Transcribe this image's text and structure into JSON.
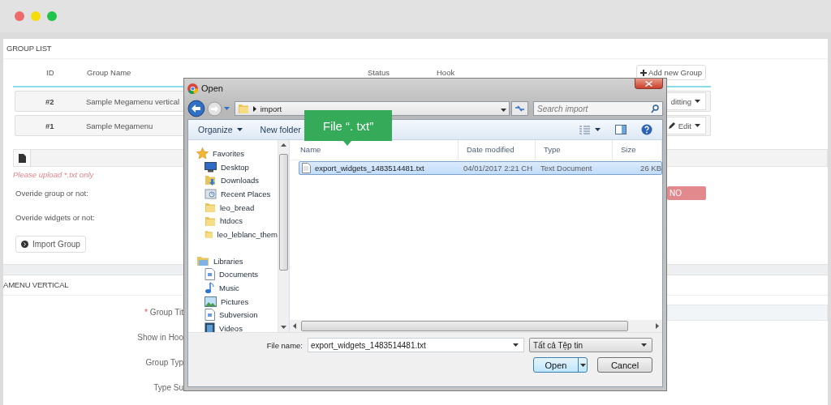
{
  "window": {
    "controls": [
      {
        "color": "#ee6b6b"
      },
      {
        "color": "#f5dc0c"
      },
      {
        "color": "#22c34a"
      }
    ]
  },
  "group_list": {
    "title": "GROUP LIST",
    "columns": [
      "ID",
      "Group Name",
      "Status",
      "Hook"
    ],
    "add_button": "Add new Group",
    "rows": [
      {
        "id": "#2",
        "name": "Sample Megamenu vertical",
        "action": "ditting"
      },
      {
        "id": "#1",
        "name": "Sample Megamenu",
        "action": "Edit"
      }
    ]
  },
  "import": {
    "hint": "Please upload *.txt only",
    "options": [
      {
        "label": "Overide group or not:",
        "toggle": "NO"
      },
      {
        "label": "Overide widgets or not:"
      }
    ],
    "button": "Import Group"
  },
  "form": {
    "title": "AMENU VERTICAL",
    "fields": [
      {
        "label": "Group Tit",
        "marker": "*"
      },
      {
        "label": "Show in Hoo"
      },
      {
        "label": "Group Typ"
      },
      {
        "label": "Type Su"
      }
    ]
  },
  "dialog": {
    "title": "Open",
    "path": "import",
    "search": {
      "placeholder": "Search import"
    },
    "toolbar": [
      "Organize",
      "New folder"
    ],
    "nav": [
      {
        "label": "Favorites",
        "kind": "star",
        "children": [
          {
            "label": "Desktop",
            "kind": "desktop"
          },
          {
            "label": "Downloads",
            "kind": "downloads"
          },
          {
            "label": "Recent Places",
            "kind": "recent"
          },
          {
            "label": "leo_bread",
            "kind": "folder"
          },
          {
            "label": "htdocs",
            "kind": "folder"
          },
          {
            "label": "leo_leblanc_them",
            "kind": "folder"
          }
        ]
      },
      {
        "label": "Libraries",
        "kind": "library",
        "children": [
          {
            "label": "Documents",
            "kind": "document"
          },
          {
            "label": "Music",
            "kind": "music"
          },
          {
            "label": "Pictures",
            "kind": "pictures"
          },
          {
            "label": "Subversion",
            "kind": "document"
          },
          {
            "label": "Videos",
            "kind": "videos"
          }
        ]
      }
    ],
    "files": {
      "columns": [
        "Name",
        "Date modified",
        "Type",
        "Size"
      ],
      "rows": [
        {
          "name": "export_widgets_1483514481.txt",
          "date": "04/01/2017 2:21 CH",
          "type": "Text Document",
          "size": "26 KB",
          "selected": true
        }
      ]
    },
    "file_name_label": "File name:",
    "file_name": "export_widgets_1483514481.txt",
    "filter": "Tất cả Tệp tin",
    "open": "Open",
    "cancel": "Cancel"
  },
  "tooltip": "File “. txt”"
}
